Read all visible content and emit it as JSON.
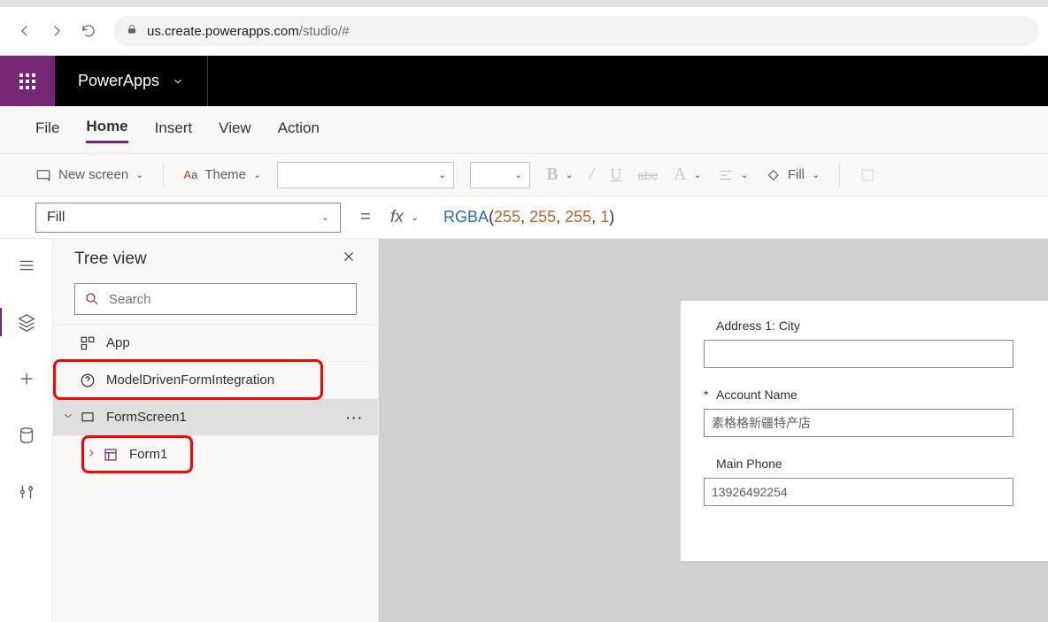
{
  "browser": {
    "url_host": "us.create.powerapps.com",
    "url_path": "/studio/#"
  },
  "app": {
    "title": "PowerApps"
  },
  "menu": {
    "items": [
      "File",
      "Home",
      "Insert",
      "View",
      "Action"
    ],
    "active_index": 1
  },
  "toolbar": {
    "new_screen": "New screen",
    "theme": "Theme",
    "bold_letter": "B",
    "slash": "/",
    "underline_letter": "U",
    "strike_abc": "abc",
    "color_letter": "A",
    "fill_label": "Fill"
  },
  "formula_bar": {
    "property": "Fill",
    "equals": "=",
    "fx": "fx",
    "fn": "RGBA",
    "args": [
      "255",
      "255",
      "255",
      "1"
    ]
  },
  "tree": {
    "title": "Tree view",
    "search_placeholder": "Search",
    "items": [
      {
        "label": "App"
      },
      {
        "label": "ModelDrivenFormIntegration"
      },
      {
        "label": "FormScreen1",
        "selected": true
      },
      {
        "label": "Form1",
        "indent": true
      }
    ]
  },
  "form": {
    "fields": [
      {
        "label": "Address 1: City",
        "value": "",
        "required": false
      },
      {
        "label": "Account Name",
        "value": "素格格新疆特产店",
        "required": true
      },
      {
        "label": "Main Phone",
        "value": "13926492254",
        "required": false
      }
    ]
  }
}
